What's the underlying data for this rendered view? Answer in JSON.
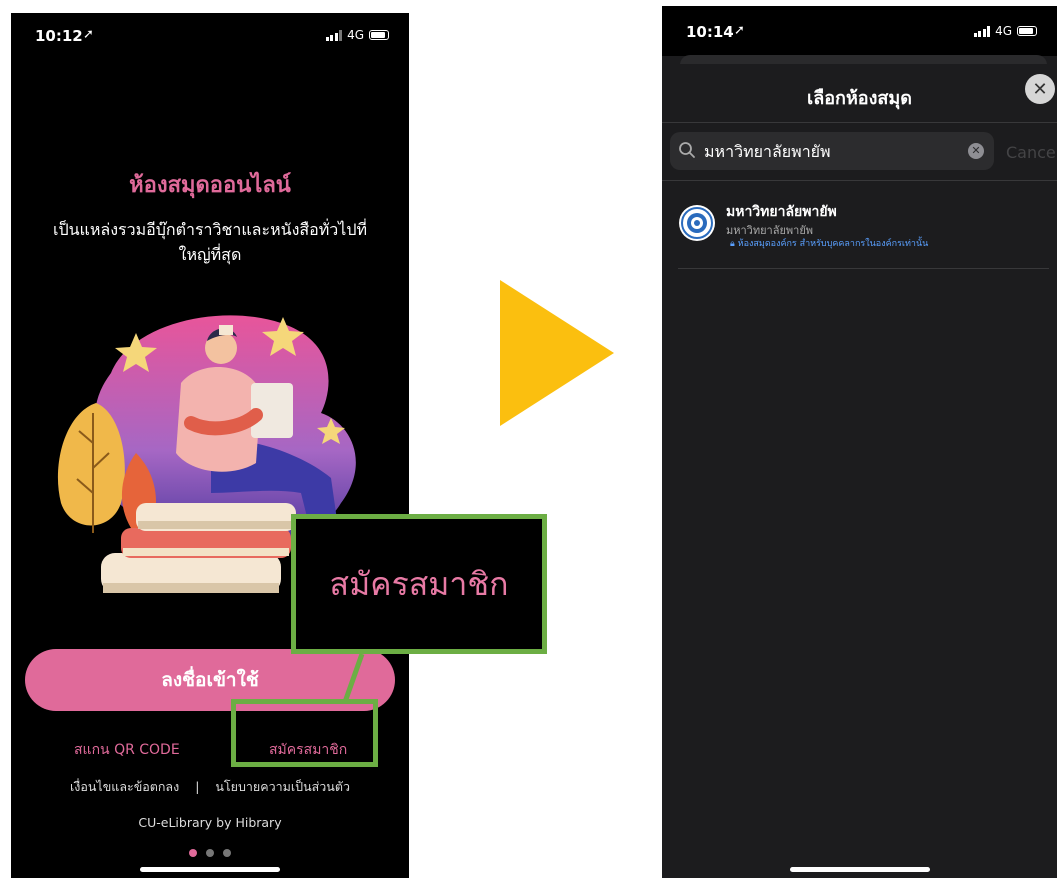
{
  "left_screen": {
    "status_time": "10:12",
    "network": "4G",
    "title": "ห้องสมุดออนไลน์",
    "subtitle": "เป็นแหล่งรวมอีบุ๊กตำราวิชาและหนังสือทั่วไปที่ใหญ่ที่สุด",
    "login_button": "ลงชื่อเข้าใช้",
    "scan_qr_link": "สแกน QR CODE",
    "register_link": "สมัครสมาชิก",
    "terms_link": "เงื่อนไขและข้อตกลง",
    "separator": "|",
    "privacy_link": "นโยบายความเป็นส่วนตัว",
    "footer": "CU-eLibrary by Hibrary",
    "page_indicator": {
      "total": 3,
      "active": 1
    }
  },
  "callout": {
    "zoom_label": "สมัครสมาชิก",
    "highlight_color": "#6cae44"
  },
  "arrow_color": "#fbbf0f",
  "right_screen": {
    "status_time": "10:14",
    "network": "4G",
    "sheet_title": "เลือกห้องสมุด",
    "search_value": "มหาวิทยาลัยพายัพ",
    "cancel_label": "Cance",
    "results": [
      {
        "name": "มหาวิทยาลัยพายัพ",
        "subtitle": "มหาวิทยาลัยพายัพ",
        "note": "ห้องสมุดองค์กร สำหรับบุคคลากรในองค์กรเท่านั้น"
      }
    ]
  },
  "colors": {
    "accent_pink": "#e06a9a",
    "link_blue": "#5aa0ff"
  }
}
